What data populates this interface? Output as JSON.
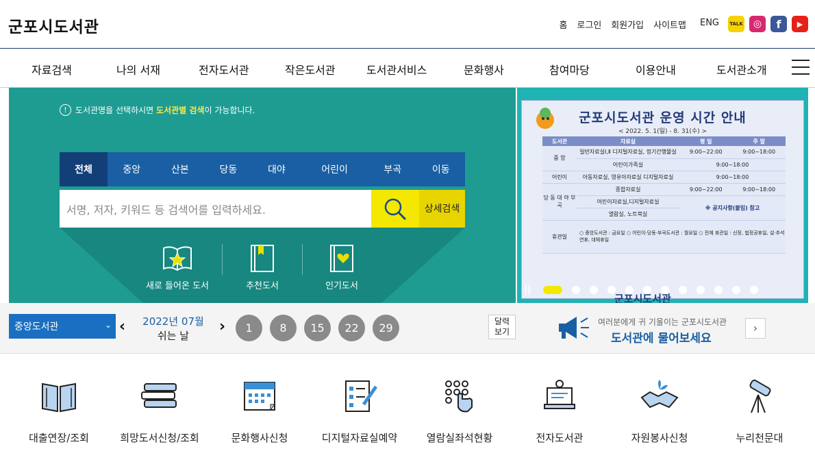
{
  "header": {
    "logo": "군포시도서관",
    "util": [
      "홈",
      "로그인",
      "회원가입",
      "사이트맵",
      "ENG"
    ]
  },
  "sns": [
    {
      "name": "kakao",
      "text": "TALK",
      "color": "#f4d300"
    },
    {
      "name": "instagram",
      "text": "◎",
      "color": "#d6296f"
    },
    {
      "name": "facebook",
      "text": "f",
      "color": "#3b5998"
    },
    {
      "name": "youtube",
      "text": "▶",
      "color": "#e62117"
    }
  ],
  "gnb": [
    "자료검색",
    "나의 서재",
    "전자도서관",
    "작은도서관",
    "도서관서비스",
    "문화행사",
    "참여마당",
    "이용안내",
    "도서관소개"
  ],
  "search": {
    "notice_pre": "도서관명을 선택하시면 ",
    "notice_hl": "도서관별 검색",
    "notice_post": "이 가능합니다.",
    "tabs": [
      "전체",
      "중앙",
      "산본",
      "당동",
      "대야",
      "어린이",
      "부곡",
      "이동"
    ],
    "placeholder": "서명, 저자, 키워드 등 검색어를 입력하세요.",
    "detail": [
      "상세",
      "검색"
    ]
  },
  "quick_books": [
    "새로 들어온 도서",
    "추천도서",
    "인기도서"
  ],
  "banner": {
    "title": "군포시도서관 운영 시간 안내",
    "subtitle": "< 2022. 5. 1(일) - 8. 31(수) >",
    "headers": [
      "도서관",
      "자료실",
      "평 일",
      "주 말"
    ],
    "rows": [
      [
        "중 앙",
        "일반자료실Ⅰ,Ⅱ 디지털자료실, 정기간행물실",
        "9:00~22:00",
        "9:00~18:00"
      ],
      [
        "",
        "어린이가족실",
        "9:00~18:00",
        ""
      ],
      [
        "어린이",
        "아동자료실, 영유아자료실 디지털자료실",
        "9:00~18:00",
        ""
      ],
      [
        "당 동 대 야 부 곡",
        "종합자료실",
        "9:00~22:00",
        "9:00~18:00"
      ],
      [
        "",
        "어린이자료실,디지털자료실",
        "※ 공지사항(붙임) 참고",
        ""
      ],
      [
        "",
        "열람실, 노트북실",
        "",
        ""
      ],
      [
        "휴관일",
        "○ 중앙도서관 : 금요일 ○ 어린이·당동·부곡도서관 : 월요일 ○ 전체 휴관일 : 신정, 법정공휴일, 설·추석연휴, 대체휴일",
        "",
        ""
      ]
    ],
    "footer_logo": "군포시도서관",
    "dot_count": 14
  },
  "strip": {
    "library": "중앙도서관",
    "month": "2022년 07월",
    "holiday_label": "쉬는 날",
    "days": [
      "1",
      "8",
      "15",
      "22",
      "29"
    ],
    "cal_btn": [
      "달력",
      "보기"
    ],
    "ask_small": "여러분에게 귀 기울이는 군포시도서관",
    "ask_big": "도서관에 물어보세요",
    "next": "›"
  },
  "quick_menu": [
    "대출연장/조회",
    "희망도서신청/조회",
    "문화행사신청",
    "디지털자료실예약",
    "열람실좌석현황",
    "전자도서관",
    "자원봉사신청",
    "누리천문대"
  ]
}
